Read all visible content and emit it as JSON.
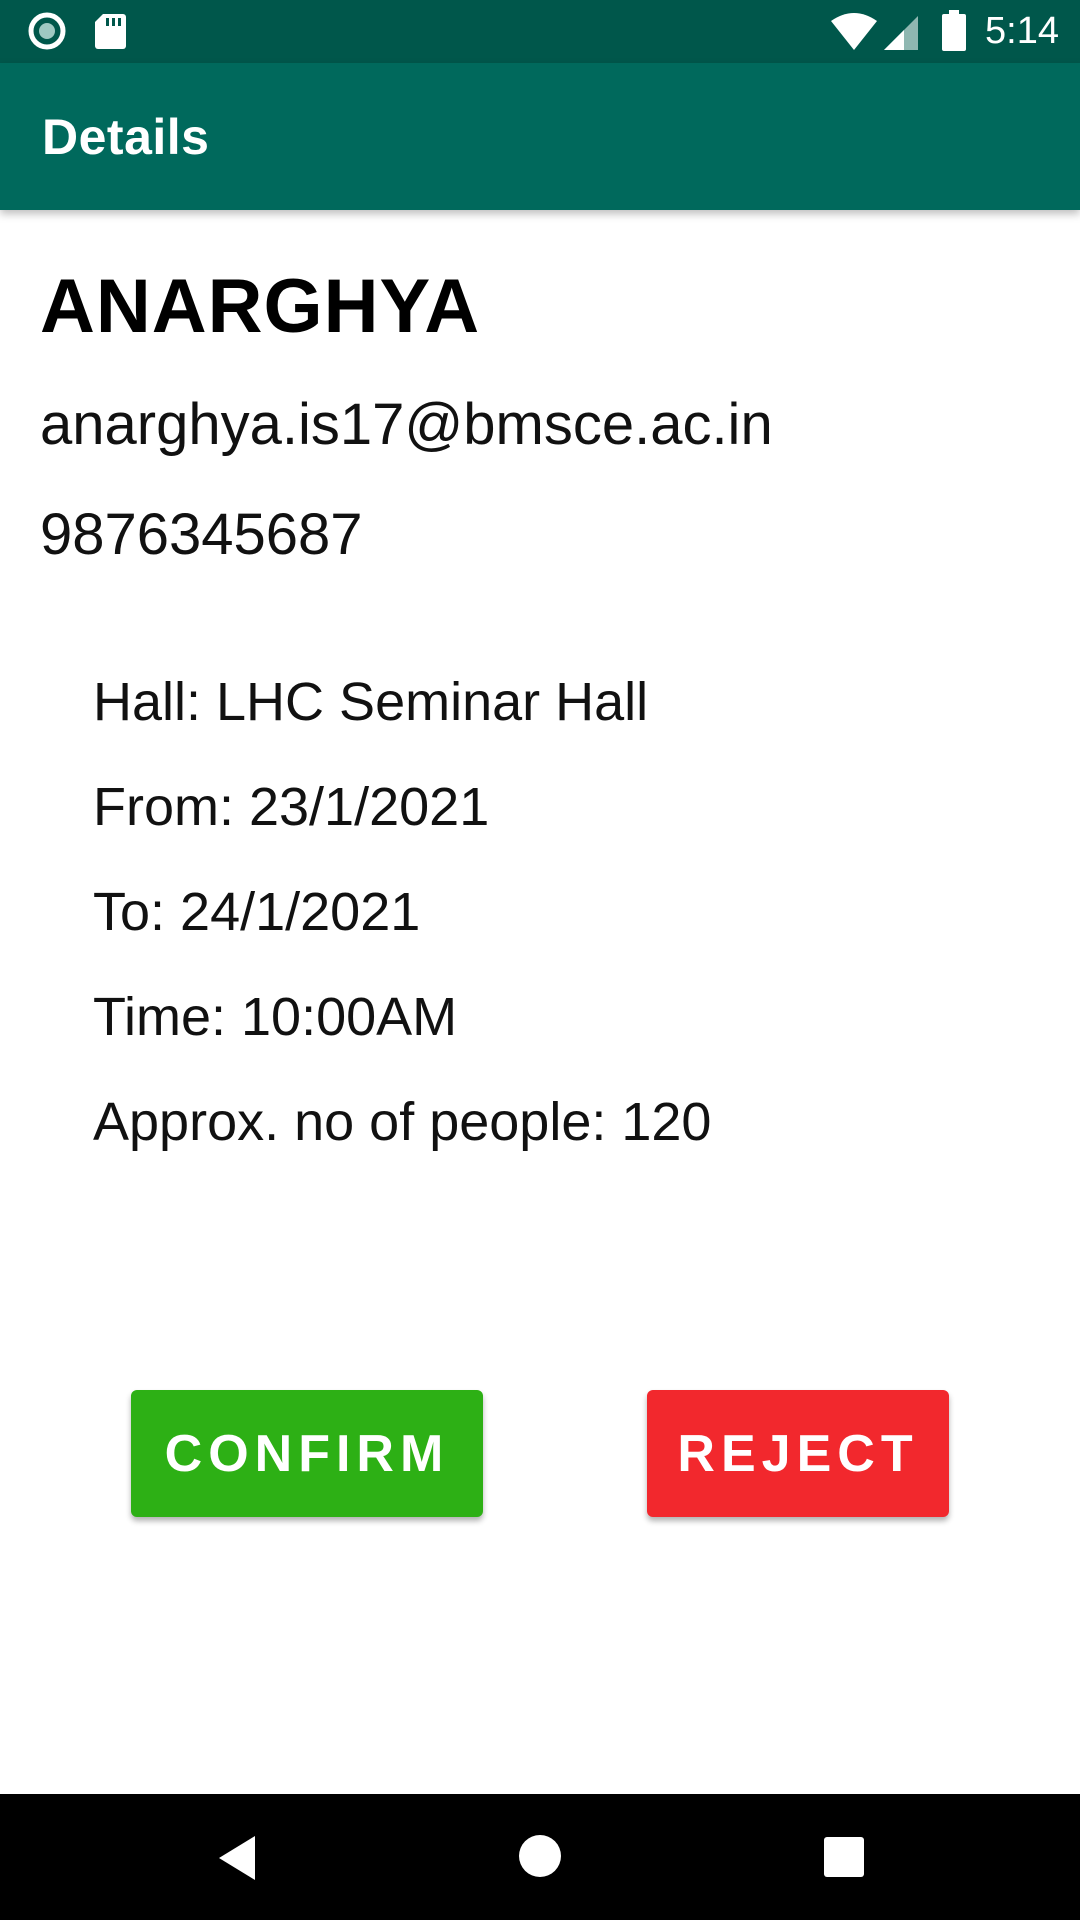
{
  "status_bar": {
    "time": "5:14",
    "icons": [
      "record-icon",
      "sd-card-icon",
      "wifi-icon",
      "cell-signal-icon",
      "battery-icon"
    ],
    "background": "#00574b"
  },
  "app_bar": {
    "title": "Details",
    "background": "#00695c"
  },
  "person": {
    "name": "ANARGHYA",
    "email": "anarghya.is17@bmsce.ac.in",
    "phone": "9876345687"
  },
  "booking": {
    "hall": "Hall: LHC Seminar Hall",
    "from": "From: 23/1/2021",
    "to": "To: 24/1/2021",
    "time": "Time: 10:00AM",
    "people": "Approx. no of people: 120"
  },
  "actions": {
    "confirm_label": "CONFIRM",
    "confirm_color": "#2db015",
    "reject_label": "REJECT",
    "reject_color": "#f2282d"
  },
  "nav_bar": {
    "icons": [
      "back-icon",
      "home-icon",
      "recents-icon"
    ]
  }
}
